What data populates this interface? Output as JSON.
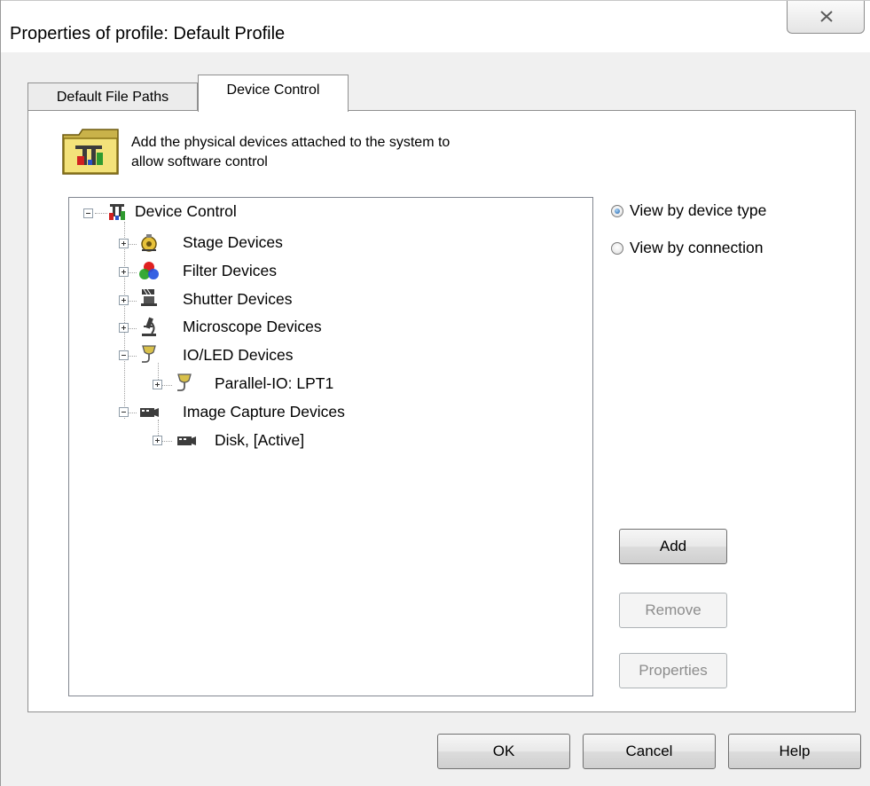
{
  "window": {
    "title": "Properties of profile: Default Profile",
    "close_icon": "close-icon"
  },
  "tabs": [
    {
      "label": "Default File Paths",
      "active": false
    },
    {
      "label": "Device Control",
      "active": true
    }
  ],
  "header": {
    "icon": "device-control-folder-icon",
    "text_line1": "Add the physical devices attached to the system to",
    "text_line2": "allow software control"
  },
  "tree": {
    "root": {
      "label": "Device Control",
      "icon": "device-control-icon",
      "expanded": true
    },
    "items": [
      {
        "label": "Stage Devices",
        "icon": "stage-icon",
        "expanded": false
      },
      {
        "label": "Filter Devices",
        "icon": "filter-icon",
        "expanded": false
      },
      {
        "label": "Shutter Devices",
        "icon": "shutter-icon",
        "expanded": false
      },
      {
        "label": "Microscope Devices",
        "icon": "microscope-icon",
        "expanded": false
      },
      {
        "label": "IO/LED Devices",
        "icon": "io-led-icon",
        "expanded": true
      },
      {
        "label": "Parallel-IO: LPT1",
        "icon": "io-led-icon",
        "expanded": false
      },
      {
        "label": "Image Capture Devices",
        "icon": "camera-icon",
        "expanded": true
      },
      {
        "label": "Disk, [Active]",
        "icon": "camera-icon",
        "expanded": false
      }
    ]
  },
  "view_options": [
    {
      "label": "View by device type",
      "checked": true
    },
    {
      "label": "View by connection",
      "checked": false
    }
  ],
  "side_buttons": {
    "add": {
      "label": "Add",
      "enabled": true
    },
    "remove": {
      "label": "Remove",
      "enabled": false
    },
    "properties": {
      "label": "Properties",
      "enabled": false
    }
  },
  "footer_buttons": {
    "ok": "OK",
    "cancel": "Cancel",
    "help": "Help"
  },
  "colors": {
    "dialog_bg": "#f0f0f0",
    "radio_selected": "#1d5fa8",
    "disabled_text": "#8d8d8d"
  }
}
